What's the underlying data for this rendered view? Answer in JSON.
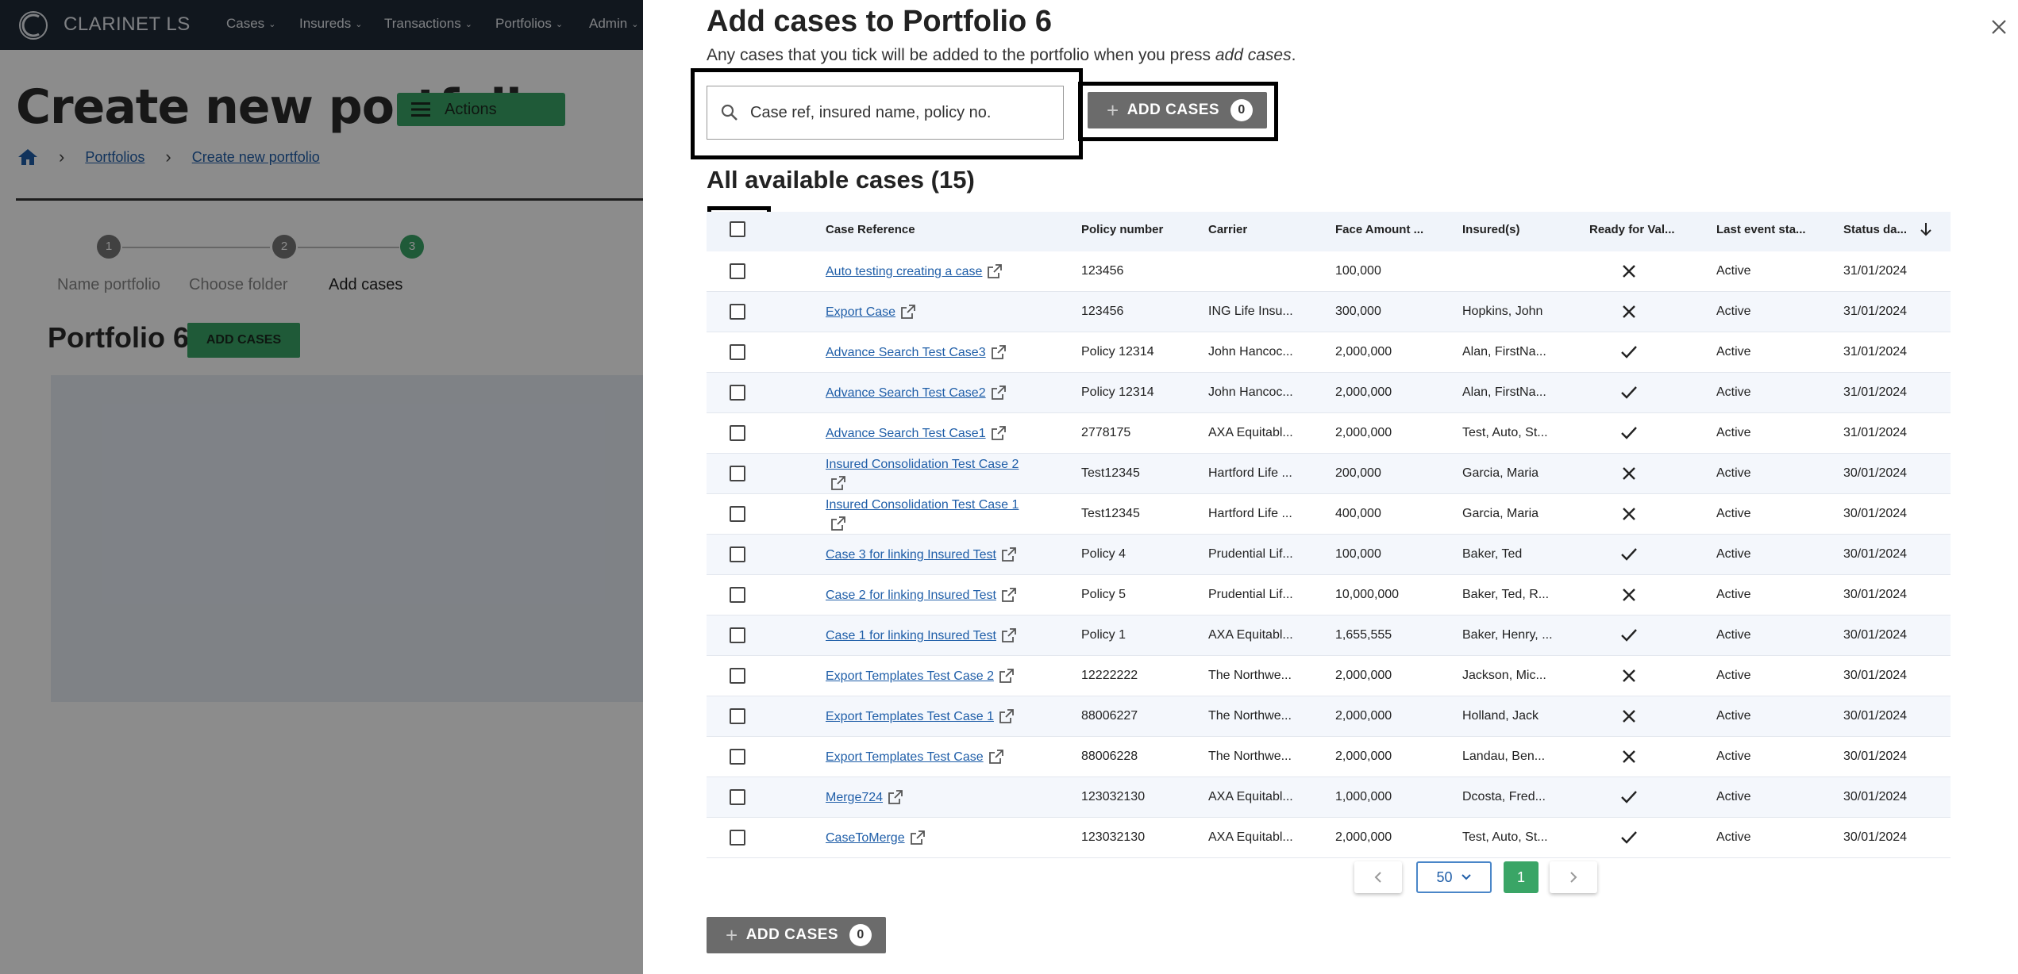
{
  "app": {
    "brand": "CLARINET LS",
    "nav": [
      "Cases",
      "Insureds",
      "Transactions",
      "Portfolios",
      "Admin"
    ],
    "page_title": "Create new portfolio",
    "actions_label": "Actions",
    "breadcrumb": [
      "Portfolios",
      "Create new portfolio"
    ],
    "steps": [
      {
        "num": "1",
        "label": "Name portfolio"
      },
      {
        "num": "2",
        "label": "Choose folder"
      },
      {
        "num": "3",
        "label": "Add cases"
      }
    ],
    "portfolio_name": "Portfolio 6",
    "add_cases_label": "ADD CASES"
  },
  "drawer": {
    "title": "Add cases to Portfolio 6",
    "subtitle_text": "Any cases that you tick will be added to the portfolio when you press ",
    "subtitle_em": "add cases",
    "subtitle_end": ".",
    "search_placeholder": "Case ref, insured name, policy no.",
    "add_button_label": "ADD CASES",
    "add_button_count": "0",
    "section_title": "All available cases (15)",
    "columns": [
      "Case Reference",
      "Policy number",
      "Carrier",
      "Face Amount ...",
      "Insured(s)",
      "Ready for Val...",
      "Last event sta...",
      "Status da..."
    ],
    "rows": [
      {
        "ref": "Auto testing creating a case",
        "policy": "123456",
        "carrier": "",
        "face": "100,000",
        "insured": "",
        "ready": false,
        "event": "Active",
        "date": "31/01/2024"
      },
      {
        "ref": "Export Case",
        "policy": "123456",
        "carrier": "ING Life Insu...",
        "face": "300,000",
        "insured": "Hopkins, John",
        "ready": false,
        "event": "Active",
        "date": "31/01/2024"
      },
      {
        "ref": "Advance Search Test Case3",
        "policy": "Policy 12314",
        "carrier": "John Hancoc...",
        "face": "2,000,000",
        "insured": "Alan, FirstNa...",
        "ready": true,
        "event": "Active",
        "date": "31/01/2024"
      },
      {
        "ref": "Advance Search Test Case2",
        "policy": "Policy 12314",
        "carrier": "John Hancoc...",
        "face": "2,000,000",
        "insured": "Alan, FirstNa...",
        "ready": true,
        "event": "Active",
        "date": "31/01/2024"
      },
      {
        "ref": "Advance Search Test Case1",
        "policy": "2778175",
        "carrier": "AXA Equitabl...",
        "face": "2,000,000",
        "insured": "Test, Auto, St...",
        "ready": true,
        "event": "Active",
        "date": "31/01/2024"
      },
      {
        "ref": "Insured Consolidation Test Case 2",
        "policy": "Test12345",
        "carrier": "Hartford Life ...",
        "face": "200,000",
        "insured": "Garcia, Maria",
        "ready": false,
        "event": "Active",
        "date": "30/01/2024"
      },
      {
        "ref": "Insured Consolidation Test Case 1",
        "policy": "Test12345",
        "carrier": "Hartford Life ...",
        "face": "400,000",
        "insured": "Garcia, Maria",
        "ready": false,
        "event": "Active",
        "date": "30/01/2024"
      },
      {
        "ref": "Case 3 for linking Insured Test",
        "policy": "Policy 4",
        "carrier": "Prudential Lif...",
        "face": "100,000",
        "insured": "Baker, Ted",
        "ready": true,
        "event": "Active",
        "date": "30/01/2024"
      },
      {
        "ref": "Case 2 for linking Insured Test",
        "policy": "Policy 5",
        "carrier": "Prudential Lif...",
        "face": "10,000,000",
        "insured": "Baker, Ted, R...",
        "ready": false,
        "event": "Active",
        "date": "30/01/2024"
      },
      {
        "ref": "Case 1 for linking Insured Test",
        "policy": "Policy 1",
        "carrier": "AXA Equitabl...",
        "face": "1,655,555",
        "insured": "Baker, Henry, ...",
        "ready": true,
        "event": "Active",
        "date": "30/01/2024"
      },
      {
        "ref": "Export Templates Test Case 2",
        "policy": "12222222",
        "carrier": "The Northwe...",
        "face": "2,000,000",
        "insured": "Jackson, Mic...",
        "ready": false,
        "event": "Active",
        "date": "30/01/2024"
      },
      {
        "ref": "Export Templates Test Case 1",
        "policy": "88006227",
        "carrier": "The Northwe...",
        "face": "2,000,000",
        "insured": "Holland, Jack",
        "ready": false,
        "event": "Active",
        "date": "30/01/2024"
      },
      {
        "ref": "Export Templates Test Case",
        "policy": "88006228",
        "carrier": "The Northwe...",
        "face": "2,000,000",
        "insured": "Landau, Ben...",
        "ready": false,
        "event": "Active",
        "date": "30/01/2024"
      },
      {
        "ref": "Merge724",
        "policy": "123032130",
        "carrier": "AXA Equitabl...",
        "face": "1,000,000",
        "insured": "Dcosta, Fred...",
        "ready": true,
        "event": "Active",
        "date": "30/01/2024"
      },
      {
        "ref": "CaseToMerge",
        "policy": "123032130",
        "carrier": "AXA Equitabl...",
        "face": "2,000,000",
        "insured": "Test, Auto, St...",
        "ready": true,
        "event": "Active",
        "date": "30/01/2024"
      }
    ],
    "pagination": {
      "page_size": "50",
      "current_page": "1"
    }
  },
  "colors": {
    "nav_bg": "#1f2a37",
    "green": "#3aa566",
    "link": "#1f5ea8",
    "button_gray": "#6b6b6b"
  }
}
